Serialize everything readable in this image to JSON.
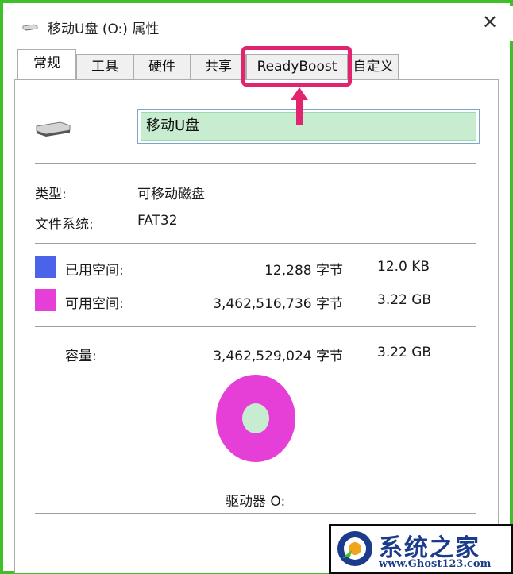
{
  "window": {
    "title": "移动U盘 (O:) 属性",
    "close_glyph": "✕"
  },
  "tabs": [
    {
      "label": "常规",
      "active": true
    },
    {
      "label": "工具",
      "active": false
    },
    {
      "label": "硬件",
      "active": false
    },
    {
      "label": "共享",
      "active": false
    },
    {
      "label": "ReadyBoost",
      "active": false
    },
    {
      "label": "自定义",
      "active": false
    }
  ],
  "general": {
    "drive_name": "移动U盘",
    "type_label": "类型:",
    "type_value": "可移动磁盘",
    "fs_label": "文件系统:",
    "fs_value": "FAT32",
    "used_label": "已用空间:",
    "used_bytes": "12,288 字节",
    "used_size": "12.0 KB",
    "free_label": "可用空间:",
    "free_bytes": "3,462,516,736 字节",
    "free_size": "3.22 GB",
    "capacity_label": "容量:",
    "capacity_bytes": "3,462,529,024 字节",
    "capacity_size": "3.22 GB",
    "drive_label": "驱动器 O:"
  },
  "colors": {
    "used": "#4a63e8",
    "free": "#e63fd8",
    "highlight": "#e0246d",
    "frame": "#3fbf2a"
  },
  "watermark": {
    "name": "系统之家",
    "url": "www.Ghost123.com"
  }
}
